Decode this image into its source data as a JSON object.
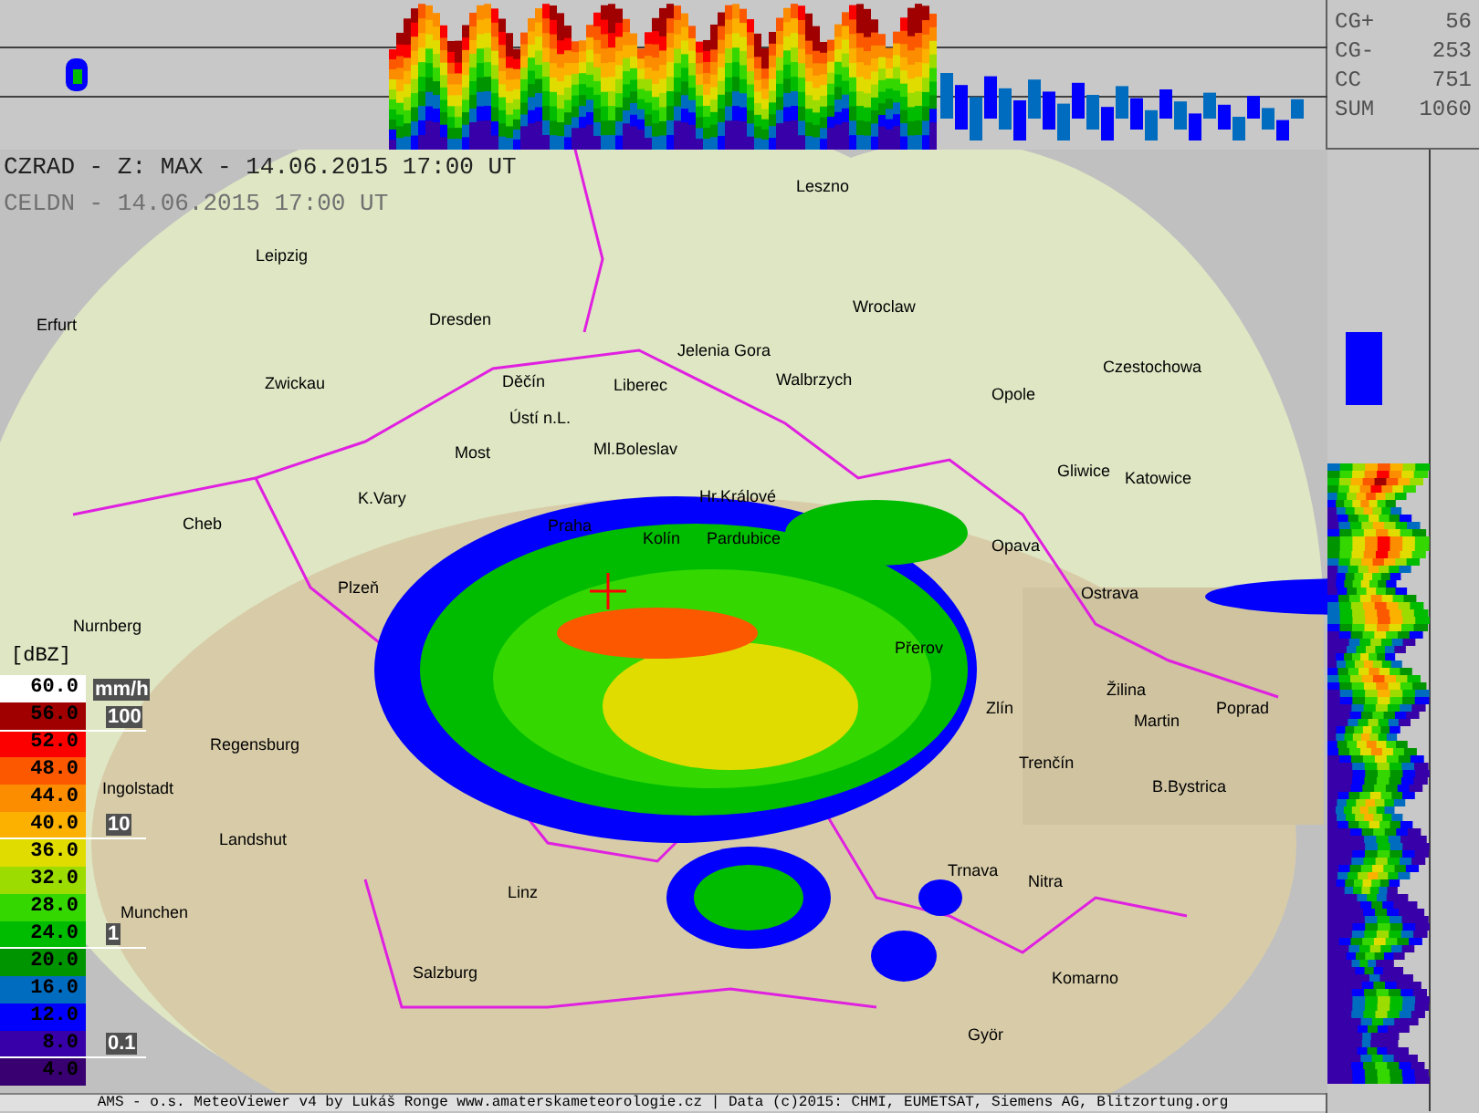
{
  "title_lines": [
    {
      "text": "CZRAD - Z: MAX - 14.06.2015 17:00 UT",
      "kind": "primary"
    },
    {
      "text": "CELDN - 14.06.2015 17:00 UT",
      "kind": "secondary"
    }
  ],
  "lightning_counts": [
    {
      "label": "CG+",
      "value": "56"
    },
    {
      "label": "CG-",
      "value": "253"
    },
    {
      "label": "CC",
      "value": "751"
    },
    {
      "label": "SUM",
      "value": "1060"
    }
  ],
  "legend": {
    "unit": "[dBZ]",
    "entries": [
      {
        "value": "60.0",
        "color": "#ffffff"
      },
      {
        "value": "56.0",
        "color": "#a00000"
      },
      {
        "value": "52.0",
        "color": "#fc0000"
      },
      {
        "value": "48.0",
        "color": "#fc5800"
      },
      {
        "value": "44.0",
        "color": "#fc8c00"
      },
      {
        "value": "40.0",
        "color": "#fcb000"
      },
      {
        "value": "36.0",
        "color": "#e0dc00"
      },
      {
        "value": "32.0",
        "color": "#9cdc00"
      },
      {
        "value": "28.0",
        "color": "#34d800"
      },
      {
        "value": "24.0",
        "color": "#00bc00"
      },
      {
        "value": "20.0",
        "color": "#009400"
      },
      {
        "value": "16.0",
        "color": "#006cc0"
      },
      {
        "value": "12.0",
        "color": "#0000fc"
      },
      {
        "value": "8.0",
        "color": "#3800a8"
      },
      {
        "value": "4.0",
        "color": "#380070"
      }
    ]
  },
  "rain_scale": {
    "unit": "mm/h",
    "marks": [
      "100",
      "10",
      "1",
      "0.1"
    ]
  },
  "cities": [
    "Leszno",
    "Leipzig",
    "Wroclaw",
    "Erfurt",
    "Dresden",
    "Jelenia Gora",
    "Czestochowa",
    "Zwickau",
    "Děčín",
    "Liberec",
    "Walbrzych",
    "Opole",
    "Ústí n.L.",
    "Most",
    "Ml.Boleslav",
    "Gliwice",
    "Katowice",
    "K.Vary",
    "Hr.Králové",
    "Cheb",
    "Praha",
    "Kolín",
    "Pardubice",
    "Opava",
    "Ostrava",
    "Plzeň",
    "Přerov",
    "Žilina",
    "Nurnberg",
    "Martin",
    "Poprad",
    "Zlín",
    "Regensburg",
    "Trenčín",
    "Ingolstadt",
    "B.Bystrica",
    "Landshut",
    "Trnava",
    "Nitra",
    "Munchen",
    "Linz",
    "Salzburg",
    "Komarno",
    "Györ"
  ],
  "footer": "AMS - o.s. MeteoViewer v4 by Lukáš Ronge www.amaterskameteorologie.cz | Data (c)2015: CHMI, EUMETSAT, Siemens AG, Blitzortung.org"
}
